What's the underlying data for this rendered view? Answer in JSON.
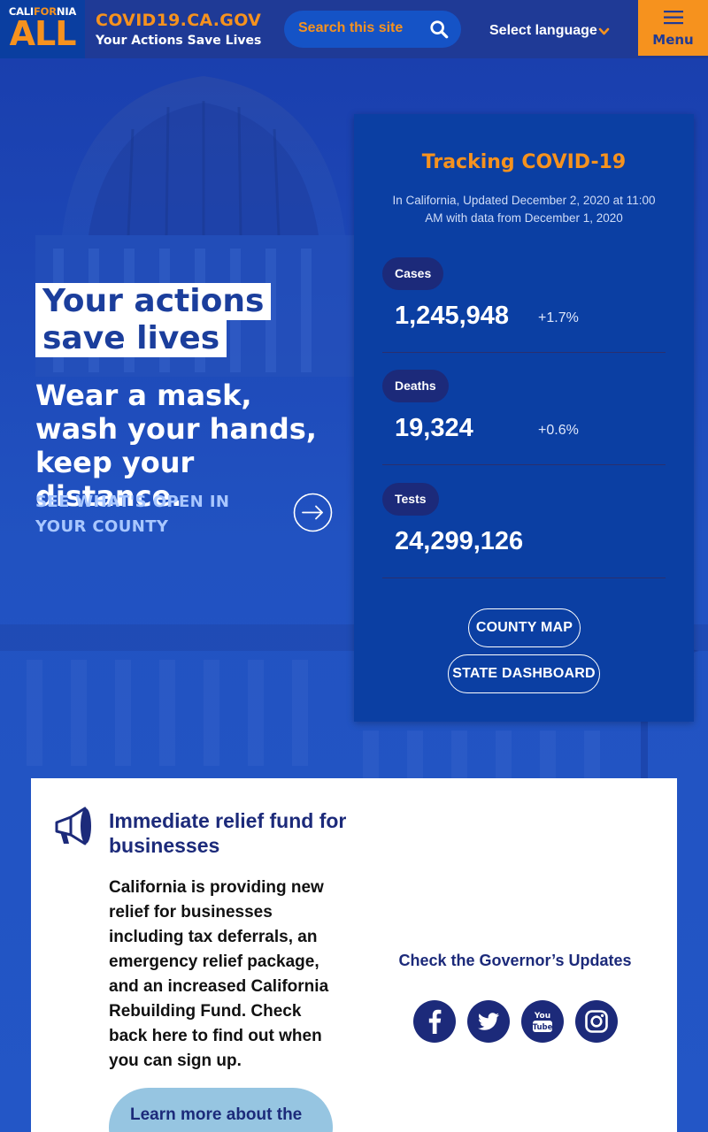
{
  "header": {
    "logo_top_left": "CALI",
    "logo_top_mid": "FOR",
    "logo_top_right": "NIA",
    "logo_main": "ALL",
    "site_name": "COVID19.CA.GOV",
    "tagline": "Your Actions Save Lives",
    "search_placeholder": "Search this site",
    "language_label": "Select language",
    "menu_label": "Menu"
  },
  "hero": {
    "headline_line1": "Your actions",
    "headline_line2": "save lives",
    "subhead": "Wear a mask, wash your hands, keep your distance.",
    "county_link": "SEE WHAT'S OPEN IN YOUR COUNTY"
  },
  "tracking": {
    "title": "Tracking COVID-19",
    "subtitle": "In California, Updated December 2, 2020 at 11:00 AM with data from December 1, 2020",
    "stats": [
      {
        "label": "Cases",
        "value": "1,245,948",
        "change": "+1.7%"
      },
      {
        "label": "Deaths",
        "value": "19,324",
        "change": "+0.6%"
      },
      {
        "label": "Tests",
        "value": "24,299,126",
        "change": ""
      }
    ],
    "county_map_label": "COUNTY MAP",
    "dashboard_label": "STATE DASHBOARD"
  },
  "panel": {
    "title": "Immediate relief fund for businesses",
    "body": "California is providing new relief for businesses including tax deferrals, an emergency relief package, and an increased California Rebuilding Fund. Check back here to find out when you can sign up.",
    "learn_more_label": "Learn more about the",
    "governor_updates": "Check the Governor’s Updates"
  },
  "colors": {
    "brand_orange": "#f6921e",
    "navy": "#1c2a7a",
    "hero_blue": "#1f4bb3",
    "card_blue": "#0b3fa3"
  },
  "icons": [
    "search-icon",
    "chevron-down-icon",
    "hamburger-icon",
    "arrow-right-circle-icon",
    "megaphone-icon",
    "facebook-icon",
    "twitter-icon",
    "youtube-icon",
    "instagram-icon"
  ]
}
